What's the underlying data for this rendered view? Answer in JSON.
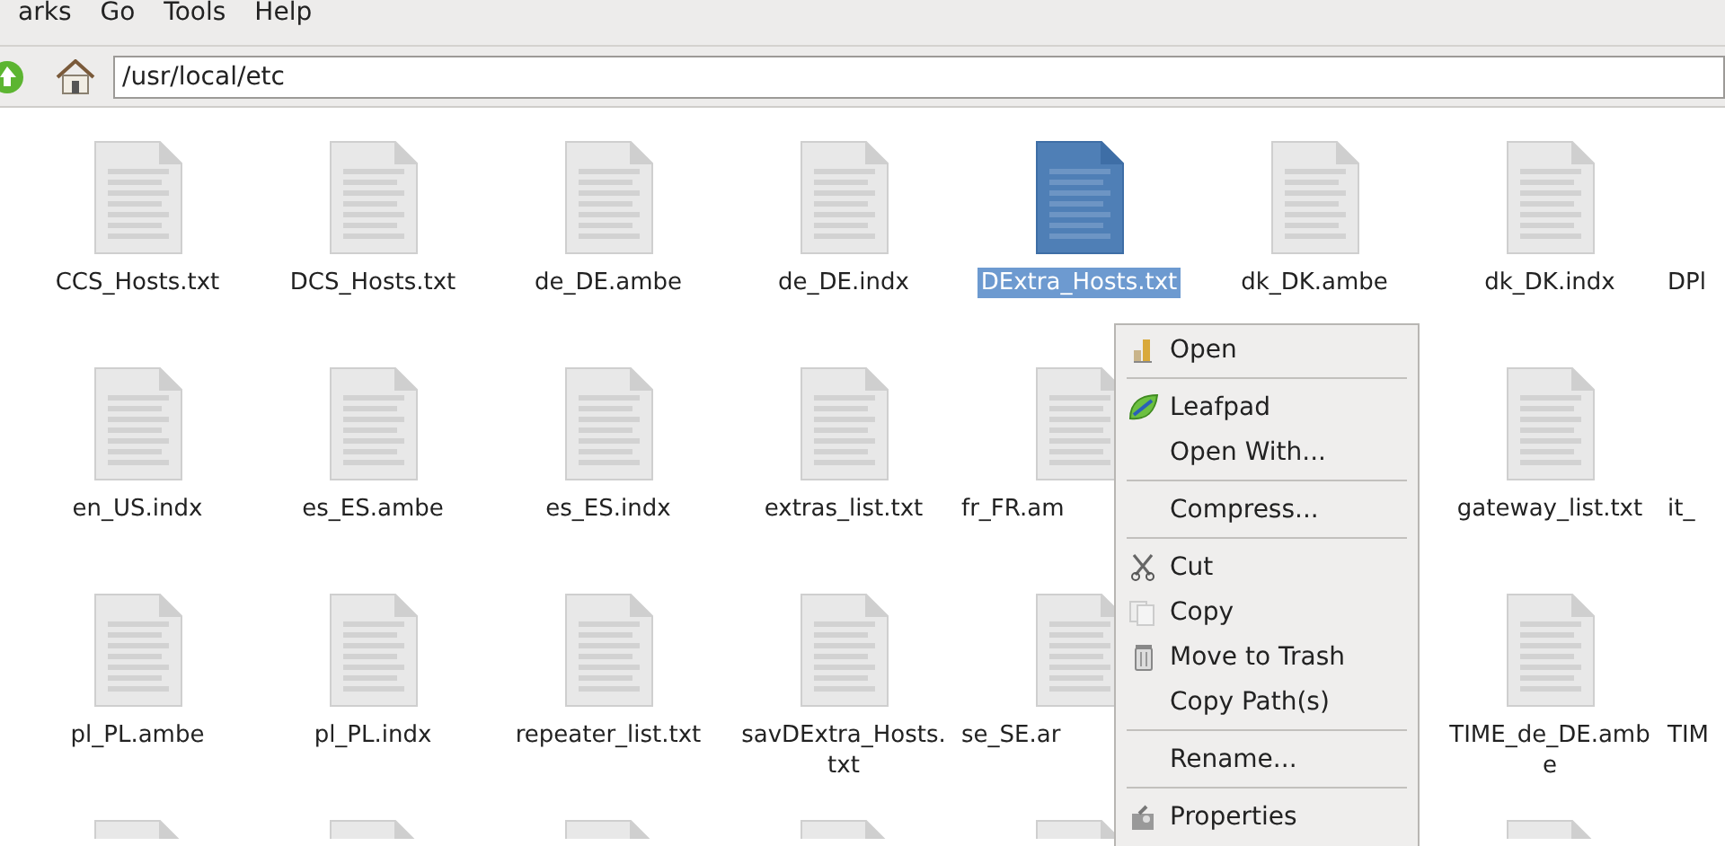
{
  "menubar": [
    {
      "label": "arks"
    },
    {
      "label": "Go"
    },
    {
      "label": "Tools"
    },
    {
      "label": "Help"
    }
  ],
  "location": {
    "value": "/usr/local/etc"
  },
  "files": [
    {
      "kind": "file",
      "name": "CCS_Hosts.txt",
      "selected": false
    },
    {
      "kind": "file",
      "name": "DCS_Hosts.txt",
      "selected": false
    },
    {
      "kind": "file",
      "name": "de_DE.ambe",
      "selected": false
    },
    {
      "kind": "file",
      "name": "de_DE.indx",
      "selected": false
    },
    {
      "kind": "file",
      "name": "DExtra_Hosts.txt",
      "selected": true
    },
    {
      "kind": "file",
      "name": "dk_DK.ambe",
      "selected": false
    },
    {
      "kind": "file",
      "name": "dk_DK.indx",
      "selected": false
    },
    {
      "kind": "edge",
      "name": "DPl"
    },
    {
      "kind": "file",
      "name": "en_US.indx",
      "selected": false
    },
    {
      "kind": "file",
      "name": "es_ES.ambe",
      "selected": false
    },
    {
      "kind": "file",
      "name": "es_ES.indx",
      "selected": false
    },
    {
      "kind": "file",
      "name": "extras_list.txt",
      "selected": false
    },
    {
      "kind": "partial",
      "name": "fr_FR.am",
      "selected": false
    },
    {
      "kind": "covered"
    },
    {
      "kind": "file",
      "name": "gateway_list.txt",
      "selected": false
    },
    {
      "kind": "edge",
      "name": "it_"
    },
    {
      "kind": "file",
      "name": "pl_PL.ambe",
      "selected": false
    },
    {
      "kind": "file",
      "name": "pl_PL.indx",
      "selected": false
    },
    {
      "kind": "file",
      "name": "repeater_list.txt",
      "selected": false
    },
    {
      "kind": "file",
      "name": "savDExtra_Hosts.txt",
      "selected": false
    },
    {
      "kind": "partial",
      "name": "se_SE.ar",
      "selected": false
    },
    {
      "kind": "covered"
    },
    {
      "kind": "file",
      "name": "TIME_de_DE.ambe",
      "selected": false
    },
    {
      "kind": "edge",
      "name": "TIM"
    },
    {
      "kind": "file",
      "selected": false
    },
    {
      "kind": "file",
      "selected": false
    },
    {
      "kind": "file",
      "selected": false
    },
    {
      "kind": "file",
      "selected": false
    },
    {
      "kind": "partial",
      "selected": false
    },
    {
      "kind": "covered"
    },
    {
      "kind": "file",
      "selected": false
    }
  ],
  "context_menu": [
    {
      "kind": "application",
      "label": "Open"
    },
    {
      "kind": "separator"
    },
    {
      "kind": "leaf",
      "label": "Leafpad"
    },
    {
      "kind": "plain",
      "label": "Open With..."
    },
    {
      "kind": "separator"
    },
    {
      "kind": "plain",
      "label": "Compress..."
    },
    {
      "kind": "separator"
    },
    {
      "kind": "scissors",
      "label": "Cut"
    },
    {
      "kind": "copy",
      "label": "Copy"
    },
    {
      "kind": "trash",
      "label": "Move to Trash"
    },
    {
      "kind": "plain",
      "label": "Copy Path(s)"
    },
    {
      "kind": "separator"
    },
    {
      "kind": "plain",
      "label": "Rename..."
    },
    {
      "kind": "separator"
    },
    {
      "kind": "properties",
      "label": "Properties"
    }
  ]
}
